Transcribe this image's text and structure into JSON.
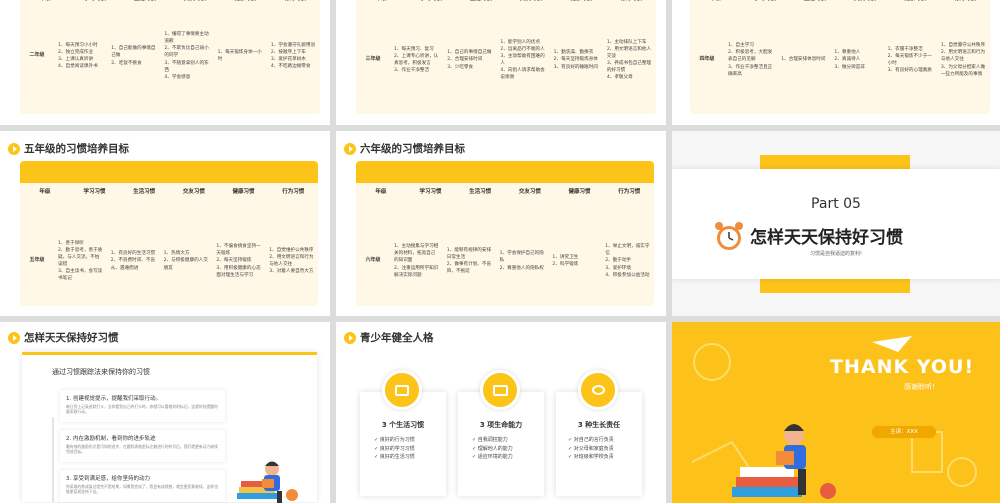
{
  "headers": [
    "年级",
    "学习习惯",
    "生活习惯",
    "交友习惯",
    "健康习惯",
    "行为习惯"
  ],
  "slide_tl": {
    "grade": "二年级",
    "cols": [
      [
        "1、每天预习小小时",
        "2、独立完成作业",
        "3、上课认真听讲",
        "4、自觉阅读课外书"
      ],
      [
        "1、自己能做的事情自己做",
        "2、吃饭不挑食"
      ],
      [
        "1、懂得了事情要主动道歉",
        "2、不欺负比自己弱小的同学",
        "3、不随意拿别人的东西",
        "4、学会感恩"
      ],
      [
        "1、每天锻炼身体一小时"
      ],
      [
        "1、学会遵守礼貌用语",
        "2、按顺序上下车",
        "3、爱护花草树木",
        "4、不吃路边摊零食"
      ]
    ]
  },
  "slide_tm": {
    "grade": "三年级",
    "cols": [
      [
        "1、每天预习、复习",
        "2、上课专心听讲，认真思考，积极发言",
        "3、作业干净整洁"
      ],
      [
        "1、自己的事情自己做",
        "2、合理安排时间",
        "3、少吃零食"
      ],
      [
        "1、能学别人的优点",
        "2、远离品行不端的人",
        "3、主动帮助有困难的人",
        "4、向别人请求帮助会说谢谢"
      ],
      [
        "1、勤洗澡、勤换衣",
        "2、每天坚持锻炼身体",
        "3、有良好的睡眠时间"
      ],
      [
        "1、主动排队上下车",
        "2、用文明语言和他人交谈",
        "3、养成书包自己整理的好习惯",
        "4、孝敬父母"
      ]
    ]
  },
  "slide_tr": {
    "grade": "四年级",
    "cols": [
      [
        "1、自主学习",
        "2、积极思考，大胆发表自己的见解",
        "3、作业干净整洁且正确率高"
      ],
      [
        "1、合理安排休息时间"
      ],
      [
        "1、尊重他人",
        "2、真诚待人",
        "3、做分辨是非"
      ],
      [
        "1、衣服干净整洁",
        "2、每天锻炼不少于一小时",
        "3、有良好的心理素质"
      ],
      [
        "1、自觉遵守公共秩序",
        "2、用文明语言和行为与他人交往",
        "3、为父母分担家人做一些力所能及的事情"
      ]
    ]
  },
  "slide_ml": {
    "title": "五年级的习惯培养目标",
    "grade": "五年级",
    "cols": [
      [
        "1、善于倾听",
        "2、勤于思考，善于质疑，与人交流，不怕误错",
        "3、自主读书，会写读书笔记"
      ],
      [
        "1、有良好的生活习惯",
        "2、不浪费时间、不盲从、遇难而进"
      ],
      [
        "1、热情大方",
        "2、与积极健康的人交朋友"
      ],
      [
        "1、不偏食挑食坚持一天锻炼",
        "2、每天坚持锻炼",
        "3、用积极健康的心态面对理生活与学习"
      ],
      [
        "1、自觉维护公共秩序",
        "2、用文明语言和行为与他人交往",
        "3、对着人要自然大方"
      ]
    ]
  },
  "slide_mm": {
    "title": "六年级的习惯培养目标",
    "grade": "六年级",
    "cols": [
      [
        "1、主动搜集与学习相关的材料，拓宽自己的知识面",
        "2、注重运用所学知识解决实际问题"
      ],
      [
        "1、能够有规律的安排日常生活",
        "2、做事有计划、不盲目、不拖延"
      ],
      [
        "1、学会保护自己的隐私",
        "2、尊重他人的隐私权"
      ],
      [
        "1、讲究卫生",
        "2、科学锻炼"
      ],
      [
        "1、举止文明，诚实守信",
        "2、勤于动手",
        "3、爱护环境",
        "4、积极参加公益活动"
      ]
    ]
  },
  "slide_mr": {
    "part": "Part 05",
    "title": "怎样天天保持好习惯",
    "subtitle": "习惯是自我逼迫的复利!"
  },
  "slide_bl": {
    "title": "怎样天天保持好习惯",
    "card_title": "通过习惯跟踪法来保持你的习惯",
    "items": [
      {
        "title": "1. 创建视觉提示，提醒我们采取行动。",
        "desc": "每日到上记录追踪打卡，当你看到自己的打卡时，你就可以看着你的标记，这就时刻提醒你要采取行动。"
      },
      {
        "title": "2. 内在激励机制，看到你的进步轨迹",
        "desc": "最有效的激励形式是可知的进步。在跟踪表格里标注着进行的符号后，我们就更有动力继续完成目标。"
      },
      {
        "title": "3. 享受到满足感，给你坚持的动力",
        "desc": "你采取的养成某过程完不是结果，如果我完成了，我会有成就感，就会更愿意继续，这样也能更容易坚持下去。"
      }
    ]
  },
  "slide_bm": {
    "title": "青少年健全人格",
    "cards": [
      {
        "title": "3 个生活习惯",
        "items": [
          "良好的行为习惯",
          "良好的学习习惯",
          "良好的生活习惯"
        ]
      },
      {
        "title": "3 项生命能力",
        "items": [
          "自我调控能力",
          "理解他人的能力",
          "适应环境的能力"
        ]
      },
      {
        "title": "3 种生长责任",
        "items": [
          "对自己的言行负责",
          "对父母和家庭负责",
          "对班级和学校负责"
        ]
      }
    ]
  },
  "slide_br": {
    "title": "THANK YOU!",
    "subtitle": "感谢聆听！",
    "speaker": "主讲：XXX"
  },
  "colors": {
    "accent": "#fcc419",
    "bg": "#fff8e6"
  }
}
